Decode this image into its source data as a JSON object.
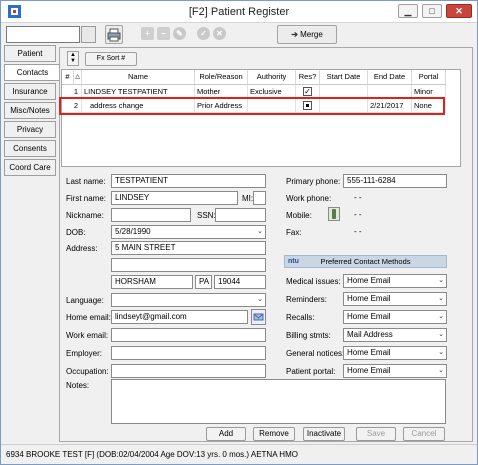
{
  "window": {
    "title": "[F2] Patient Register"
  },
  "toolbar": {
    "merge_label": "Merge"
  },
  "tabs": [
    {
      "label": "Patient",
      "active": false
    },
    {
      "label": "Contacts",
      "active": true
    },
    {
      "label": "Insurance",
      "active": false
    },
    {
      "label": "Misc/Notes",
      "active": false
    },
    {
      "label": "Privacy",
      "active": false
    },
    {
      "label": "Consents",
      "active": false
    },
    {
      "label": "Coord Care",
      "active": false
    }
  ],
  "grid": {
    "sort_label": "Fx Sort #",
    "columns": [
      "#",
      "Name",
      "Role/Reason",
      "Authority",
      "Res?",
      "Start Date",
      "End Date",
      "Portal"
    ],
    "rows": [
      {
        "num": "1",
        "name": "LINDSEY  TESTPATIENT",
        "role": "Mother",
        "authority": "Exclusive",
        "res": "checked",
        "start": "",
        "end": "",
        "portal": "Minor"
      },
      {
        "num": "2",
        "name": "address change",
        "role": "Prior Address",
        "authority": "",
        "res": "filled",
        "start": "",
        "end": "2/21/2017",
        "portal": "None"
      }
    ]
  },
  "form": {
    "labels": {
      "last_name": "Last name:",
      "first_name": "First name:",
      "mi": "MI:",
      "nickname": "Nickname:",
      "ssn": "SSN:",
      "dob": "DOB:",
      "address": "Address:",
      "language": "Language:",
      "home_email": "Home email:",
      "work_email": "Work email:",
      "employer": "Employer:",
      "occupation": "Occupation:",
      "notes": "Notes:"
    },
    "values": {
      "last_name": "TESTPATIENT",
      "first_name": "LINDSEY",
      "mi": "",
      "nickname": "",
      "ssn": "",
      "dob": "5/28/1990",
      "address1": "5 MAIN STREET",
      "address2": "",
      "city": "HORSHAM",
      "state": "PA",
      "zip": "19044",
      "language": "",
      "home_email": "lindseyt@gmail.com",
      "work_email": "",
      "employer": "",
      "occupation": ""
    }
  },
  "phones": {
    "labels": {
      "primary": "Primary phone:",
      "work": "Work phone:",
      "mobile": "Mobile:",
      "fax": "Fax:"
    },
    "values": {
      "primary": "555-111-6284",
      "work": "-    -",
      "mobile": "-    -",
      "fax": "-    -"
    }
  },
  "preferred": {
    "header": "Preferred Contact Methods",
    "items": [
      {
        "label": "Medical issues:",
        "value": "Home Email"
      },
      {
        "label": "Reminders:",
        "value": "Home Email"
      },
      {
        "label": "Recalls:",
        "value": "Home Email"
      },
      {
        "label": "Billing stmts:",
        "value": "Mail Address"
      },
      {
        "label": "General notices:",
        "value": "Home Email"
      },
      {
        "label": "Patient portal:",
        "value": "Home Email"
      }
    ]
  },
  "buttons": {
    "add": "Add",
    "remove": "Remove",
    "inactivate": "Inactivate",
    "save": "Save",
    "cancel": "Cancel"
  },
  "status": {
    "text": "6934 BROOKE TEST [F] (DOB:02/04/2004  Age DOV:13 yrs. 0 mos.) AETNA HMO"
  },
  "colors": {
    "highlight": "#e01f1f",
    "pref_header": "#c9d6e6",
    "close": "#c9463d"
  }
}
